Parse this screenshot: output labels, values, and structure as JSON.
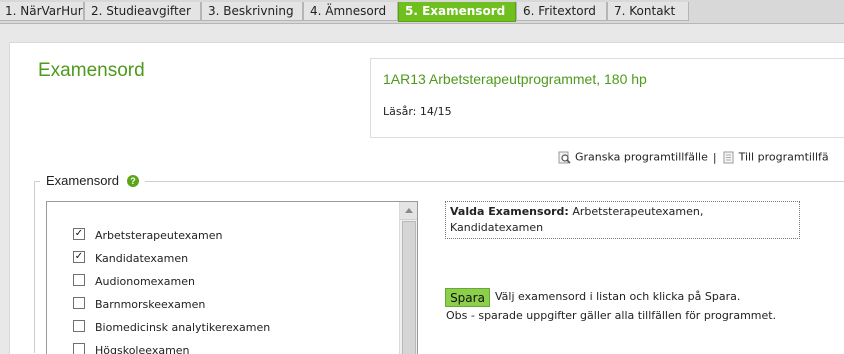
{
  "tabs": [
    {
      "label": "1. NärVarHur"
    },
    {
      "label": "2. Studieavgifter"
    },
    {
      "label": "3. Beskrivning"
    },
    {
      "label": "4. Ämnesord"
    },
    {
      "label": "5. Examensord",
      "active": true
    },
    {
      "label": "6. Fritextord"
    },
    {
      "label": "7. Kontakt"
    }
  ],
  "page": {
    "title": "Examensord",
    "program_title": "1AR13  Arbetsterapeutprogrammet, 180 hp",
    "academic_year": "Läsår: 14/15",
    "link_review": "Granska programtillfälle",
    "link_separator": "|",
    "link_to": "Till programtillfä"
  },
  "section": {
    "legend": "Examensord",
    "help_icon": "question-icon"
  },
  "degree_list": [
    {
      "label": "Arbetsterapeutexamen",
      "checked": true
    },
    {
      "label": "Kandidatexamen",
      "checked": true
    },
    {
      "label": "Audionomexamen",
      "checked": false
    },
    {
      "label": "Barnmorskeexamen",
      "checked": false
    },
    {
      "label": "Biomedicinsk analytikerexamen",
      "checked": false
    },
    {
      "label": "Högskoleexamen",
      "checked": false
    }
  ],
  "selected": {
    "heading": "Valda Examensord:",
    "value": "Arbetsterapeutexamen, Kandidatexamen"
  },
  "save": {
    "button_label": "Spara",
    "instruction": "Välj examensord i listan och klicka på Spara.",
    "note": "Obs - sparade uppgifter gäller alla tillfällen för programmet."
  },
  "colors": {
    "accent_green": "#4e9a1c",
    "active_tab": "#6fbf1f",
    "save_button": "#8ccf4a"
  }
}
